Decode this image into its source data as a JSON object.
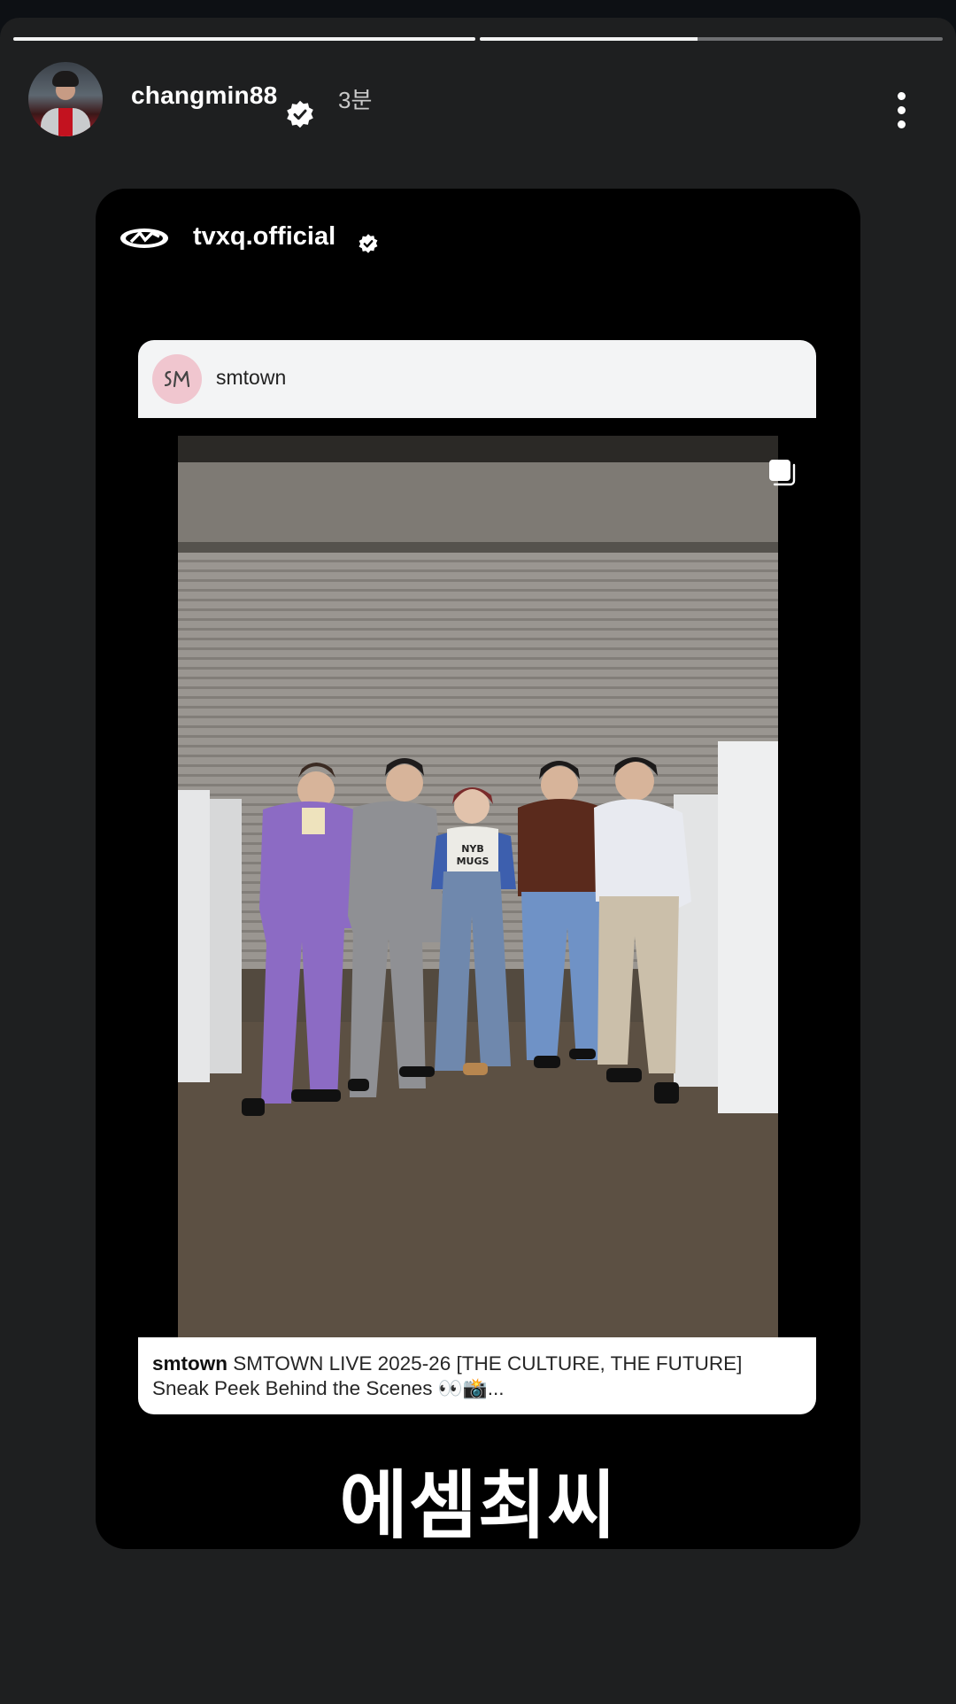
{
  "story": {
    "progress": [
      1.0,
      0.47
    ],
    "username": "changmin88",
    "time_ago": "3분",
    "more_label": "⋮"
  },
  "shared_card": {
    "username": "tvxq.official",
    "post": {
      "username": "smtown",
      "caption_user": "smtown",
      "caption_text": "SMTOWN LIVE 2025-26 [THE CULTURE, THE FUTURE] Sneak Peek Behind the Scenes 👀📸...",
      "photo_shirt_text": "NYB MUGS"
    },
    "overlay_text": "에셈최씨"
  },
  "colors": {
    "story_bg": "#1e1f20",
    "card_bg": "#000000",
    "verified_blue": "#ffffff"
  }
}
